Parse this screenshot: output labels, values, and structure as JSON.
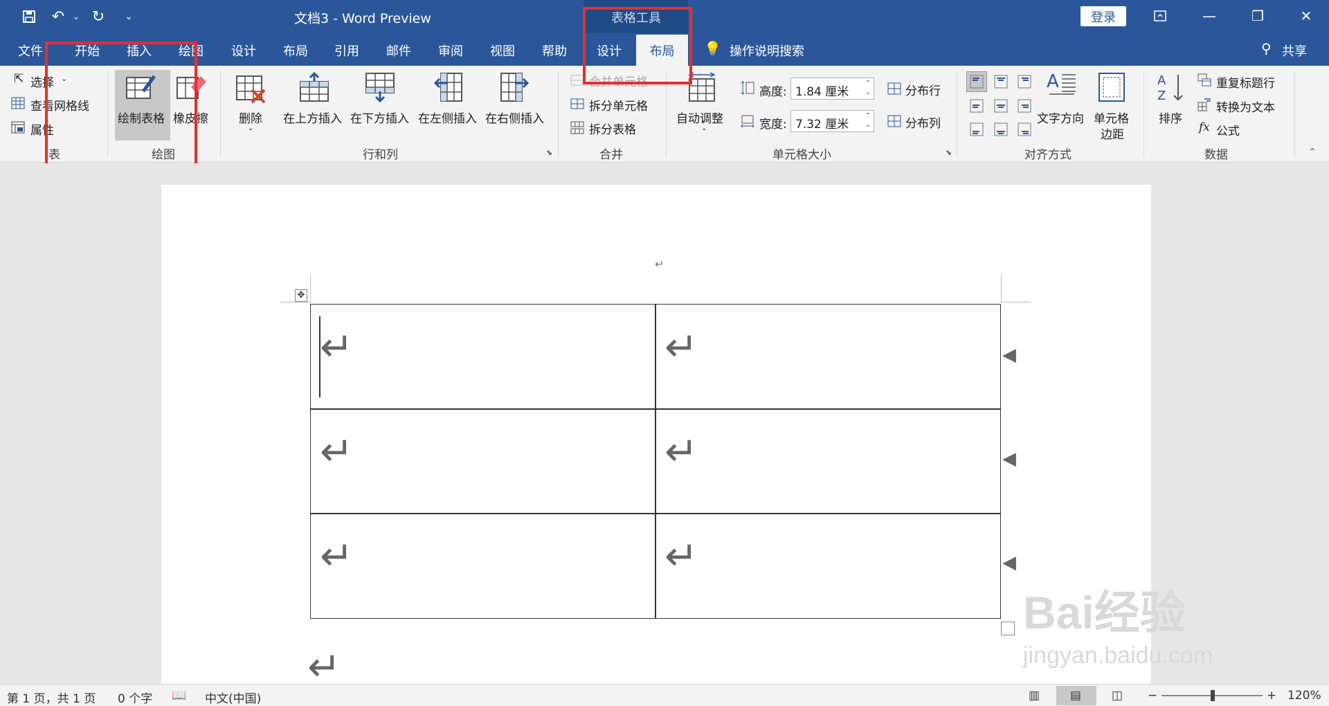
{
  "titlebar": {
    "icons": [
      "save-icon",
      "undo-icon",
      "redo-icon",
      "customize-icon"
    ],
    "title": "文档3  -  Word Preview",
    "context_label": "表格工具",
    "login": "登录",
    "share": "共享"
  },
  "tabs": [
    "文件",
    "开始",
    "插入",
    "绘图",
    "设计",
    "布局",
    "引用",
    "邮件",
    "审阅",
    "视图",
    "帮助"
  ],
  "context_tabs": {
    "design": "设计",
    "layout": "布局"
  },
  "tell_me": "操作说明搜索",
  "ribbon": {
    "table_group": {
      "select": "选择",
      "gridlines": "查看网格线",
      "properties": "属性",
      "label": "表"
    },
    "draw_group": {
      "draw_table": "绘制表格",
      "eraser": "橡皮擦",
      "label": "绘图"
    },
    "rows_cols_group": {
      "delete": "删除",
      "insert_above": "在上方插入",
      "insert_below": "在下方插入",
      "insert_left": "在左侧插入",
      "insert_right": "在右侧插入",
      "label": "行和列"
    },
    "merge_group": {
      "merge_cells": "合并单元格",
      "split_cells": "拆分单元格",
      "split_table": "拆分表格",
      "label": "合并"
    },
    "cell_size_group": {
      "autofit": "自动调整",
      "height_label": "高度:",
      "height_value": "1.84 厘米",
      "width_label": "宽度:",
      "width_value": "7.32 厘米",
      "distribute_rows": "分布行",
      "distribute_cols": "分布列",
      "label": "单元格大小"
    },
    "alignment_group": {
      "text_direction": "文字方向",
      "cell_margins_1": "单元格",
      "cell_margins_2": "边距",
      "label": "对齐方式"
    },
    "data_group": {
      "sort": "排序",
      "repeat_header": "重复标题行",
      "convert_text": "转换为文本",
      "formula": "公式",
      "label": "数据"
    }
  },
  "document": {
    "paragraph_mark": "↵",
    "table": {
      "rows": 3,
      "cols": 2,
      "cells": [
        [
          "↵",
          "↵"
        ],
        [
          "↵",
          "↵"
        ],
        [
          "↵",
          "↵"
        ]
      ]
    }
  },
  "watermark": {
    "line1": "Bai经验",
    "line2": "jingyan.baidu.com"
  },
  "statusbar": {
    "page": "第 1 页，共 1 页",
    "words": "0 个字",
    "language": "中文(中国)",
    "zoom": "120%"
  },
  "colors": {
    "title_bar": "#2b579a",
    "context_tab": "#1e4a86",
    "highlight": "#ee2b2b",
    "ribbon_bg": "#f3f3f3"
  }
}
